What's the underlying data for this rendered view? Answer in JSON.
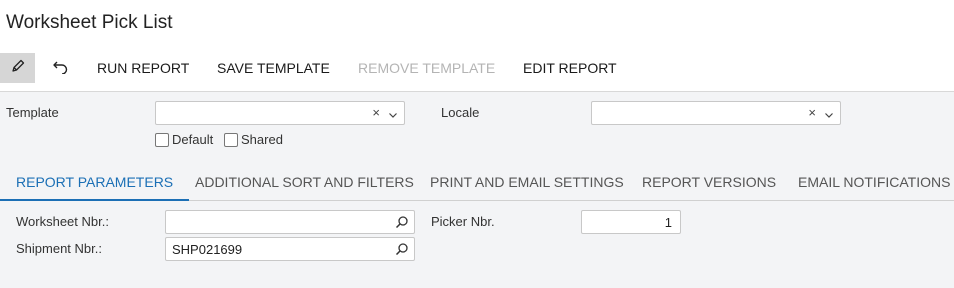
{
  "page": {
    "title": "Worksheet Pick List"
  },
  "toolbar": {
    "edit_icon": "pencil-icon",
    "undo_icon": "undo-icon",
    "run_report": "RUN REPORT",
    "save_template": "SAVE TEMPLATE",
    "remove_template": "REMOVE TEMPLATE",
    "edit_report": "EDIT REPORT"
  },
  "template_section": {
    "template_label": "Template",
    "template_value": "",
    "locale_label": "Locale",
    "locale_value": "",
    "clear_glyph": "×",
    "default_label": "Default",
    "shared_label": "Shared",
    "default_checked": false,
    "shared_checked": false
  },
  "tabs": [
    {
      "label": "REPORT PARAMETERS",
      "active": true
    },
    {
      "label": "ADDITIONAL SORT AND FILTERS",
      "active": false
    },
    {
      "label": "PRINT AND EMAIL SETTINGS",
      "active": false
    },
    {
      "label": "REPORT VERSIONS",
      "active": false
    },
    {
      "label": "EMAIL NOTIFICATIONS",
      "active": false
    }
  ],
  "parameters": {
    "worksheet_nbr_label": "Worksheet Nbr.:",
    "worksheet_nbr_value": "",
    "shipment_nbr_label": "Shipment Nbr.:",
    "shipment_nbr_value": "SHP021699",
    "picker_nbr_label": "Picker Nbr.",
    "picker_nbr_value": "1"
  },
  "colors": {
    "accent": "#1b6fb5",
    "panel": "#f3f4f6",
    "disabled": "#b4b4b4"
  }
}
